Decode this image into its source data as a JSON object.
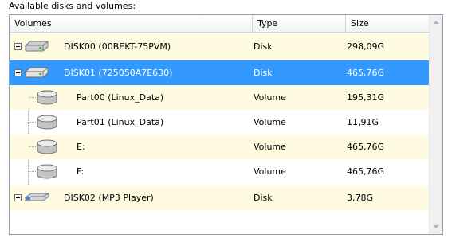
{
  "caption": "Available disks and volumes:",
  "columns": {
    "name": "Volumes",
    "type": "Type",
    "size": "Size"
  },
  "rows": [
    {
      "name": "DISK00 (00BEKT-75PVM)",
      "type": "Disk",
      "size": "298,09G",
      "icon": "hard-disk-icon",
      "expander": "+"
    },
    {
      "name": "DISK01 (725050A7E630)",
      "type": "Disk",
      "size": "465,76G",
      "icon": "hard-disk-icon",
      "expander": "-",
      "selected": true
    },
    {
      "name": "Part00 (Linux_Data)",
      "type": "Volume",
      "size": "195,31G",
      "icon": "volume-icon"
    },
    {
      "name": "Part01 (Linux_Data)",
      "type": "Volume",
      "size": "11,91G",
      "icon": "volume-icon"
    },
    {
      "name": "E:",
      "type": "Volume",
      "size": "465,76G",
      "icon": "volume-icon"
    },
    {
      "name": "F:",
      "type": "Volume",
      "size": "465,76G",
      "icon": "volume-icon"
    },
    {
      "name": "DISK02 (MP3 Player)",
      "type": "Disk",
      "size": "3,78G",
      "icon": "usb-drive-icon",
      "expander": "+"
    }
  ],
  "colors": {
    "selection": "#3399ff",
    "alt_row": "#fffbe0"
  }
}
